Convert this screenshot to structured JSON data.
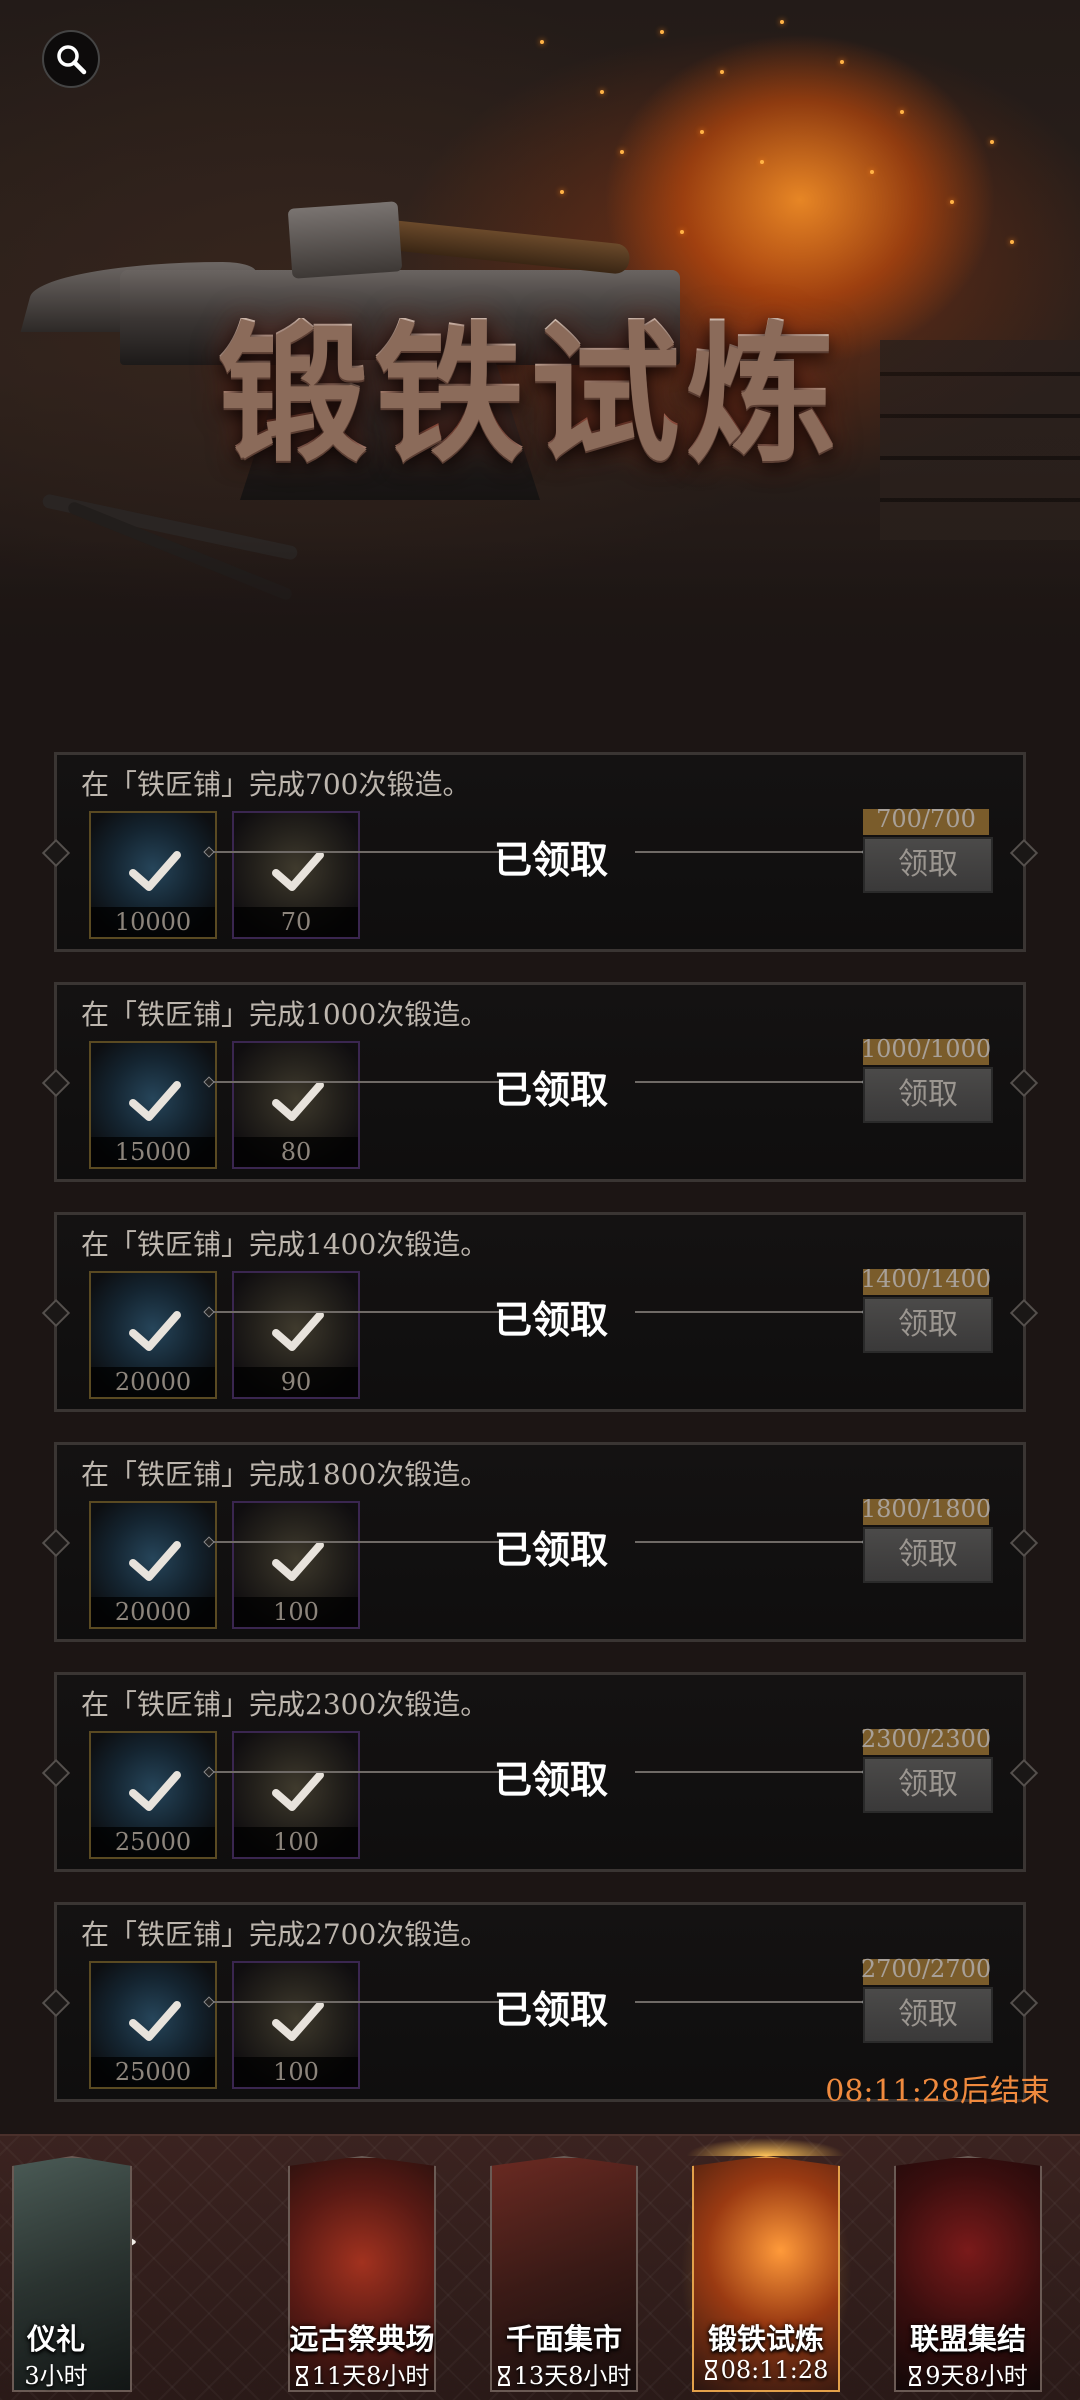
{
  "banner": {
    "title": "锻铁试炼"
  },
  "icons": {
    "search": "search-icon",
    "back": "back-arrow-icon",
    "check": "checkmark-icon",
    "hourglass": "hourglass-icon"
  },
  "tasks": [
    {
      "desc": "在「铁匠铺」完成700次锻造。",
      "reward1_qty": "10000",
      "reward2_qty": "70",
      "status": "已领取",
      "progress_text": "700/700",
      "progress": 1.0,
      "claim_label": "领取"
    },
    {
      "desc": "在「铁匠铺」完成1000次锻造。",
      "reward1_qty": "15000",
      "reward2_qty": "80",
      "status": "已领取",
      "progress_text": "1000/1000",
      "progress": 1.0,
      "claim_label": "领取"
    },
    {
      "desc": "在「铁匠铺」完成1400次锻造。",
      "reward1_qty": "20000",
      "reward2_qty": "90",
      "status": "已领取",
      "progress_text": "1400/1400",
      "progress": 1.0,
      "claim_label": "领取"
    },
    {
      "desc": "在「铁匠铺」完成1800次锻造。",
      "reward1_qty": "20000",
      "reward2_qty": "100",
      "status": "已领取",
      "progress_text": "1800/1800",
      "progress": 1.0,
      "claim_label": "领取"
    },
    {
      "desc": "在「铁匠铺」完成2300次锻造。",
      "reward1_qty": "25000",
      "reward2_qty": "100",
      "status": "已领取",
      "progress_text": "2300/2300",
      "progress": 1.0,
      "claim_label": "领取"
    },
    {
      "desc": "在「铁匠铺」完成2700次锻造。",
      "reward1_qty": "25000",
      "reward2_qty": "100",
      "status": "已领取",
      "progress_text": "2700/2700",
      "progress": 1.0,
      "claim_label": "领取"
    }
  ],
  "countdown": "08:11:28后结束",
  "events": [
    {
      "label": "仪礼",
      "timer": "3小时"
    },
    {
      "label": "远古祭典场",
      "timer": "11天8小时"
    },
    {
      "label": "千面集市",
      "timer": "13天8小时"
    },
    {
      "label": "锻铁试炼",
      "timer": "08:11:28",
      "active": true
    },
    {
      "label": "联盟集结",
      "timer": "9天8小时"
    }
  ],
  "colors": {
    "accent_orange": "#f08a3e",
    "active_glow": "#e2a04a",
    "card_bg": "#0f0e0e",
    "gold_frame": "#5a4a22",
    "purple_frame": "#3a2650"
  }
}
